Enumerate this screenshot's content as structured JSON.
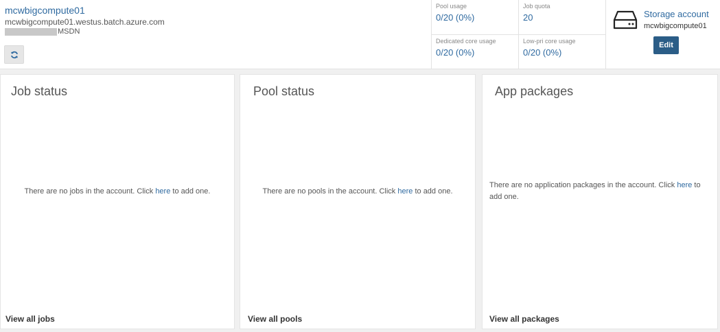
{
  "header": {
    "account_name": "mcwbigcompute01",
    "account_url": "mcwbigcompute01.westus.batch.azure.com",
    "subscription": "MSDN",
    "refresh_icon": "refresh-icon"
  },
  "quotas": [
    {
      "label": "Pool usage",
      "value": "0/20 (0%)"
    },
    {
      "label": "Job quota",
      "value": "20"
    },
    {
      "label": "Dedicated core usage",
      "value": "0/20 (0%)"
    },
    {
      "label": "Low-pri core usage",
      "value": "0/20 (0%)"
    }
  ],
  "storage": {
    "icon": "hard-drive-icon",
    "title": "Storage account",
    "name": "mcwbigcompute01",
    "edit_label": "Edit"
  },
  "cards": {
    "jobs": {
      "title": "Job status",
      "empty_prefix": "There are no jobs in the account. Click ",
      "link": "here",
      "empty_suffix": " to add one.",
      "footer": "View all jobs"
    },
    "pools": {
      "title": "Pool status",
      "empty_prefix": "There are no pools in the account. Click ",
      "link": "here",
      "empty_suffix": " to add one.",
      "footer": "View all pools"
    },
    "packages": {
      "title": "App packages",
      "empty_prefix": "There are no application packages in the account. Click ",
      "link": "here",
      "empty_suffix": " to add one.",
      "footer": "View all packages"
    }
  },
  "colors": {
    "accent": "#2f6aa0",
    "button": "#2b5d87",
    "background": "#f0f0f0"
  }
}
